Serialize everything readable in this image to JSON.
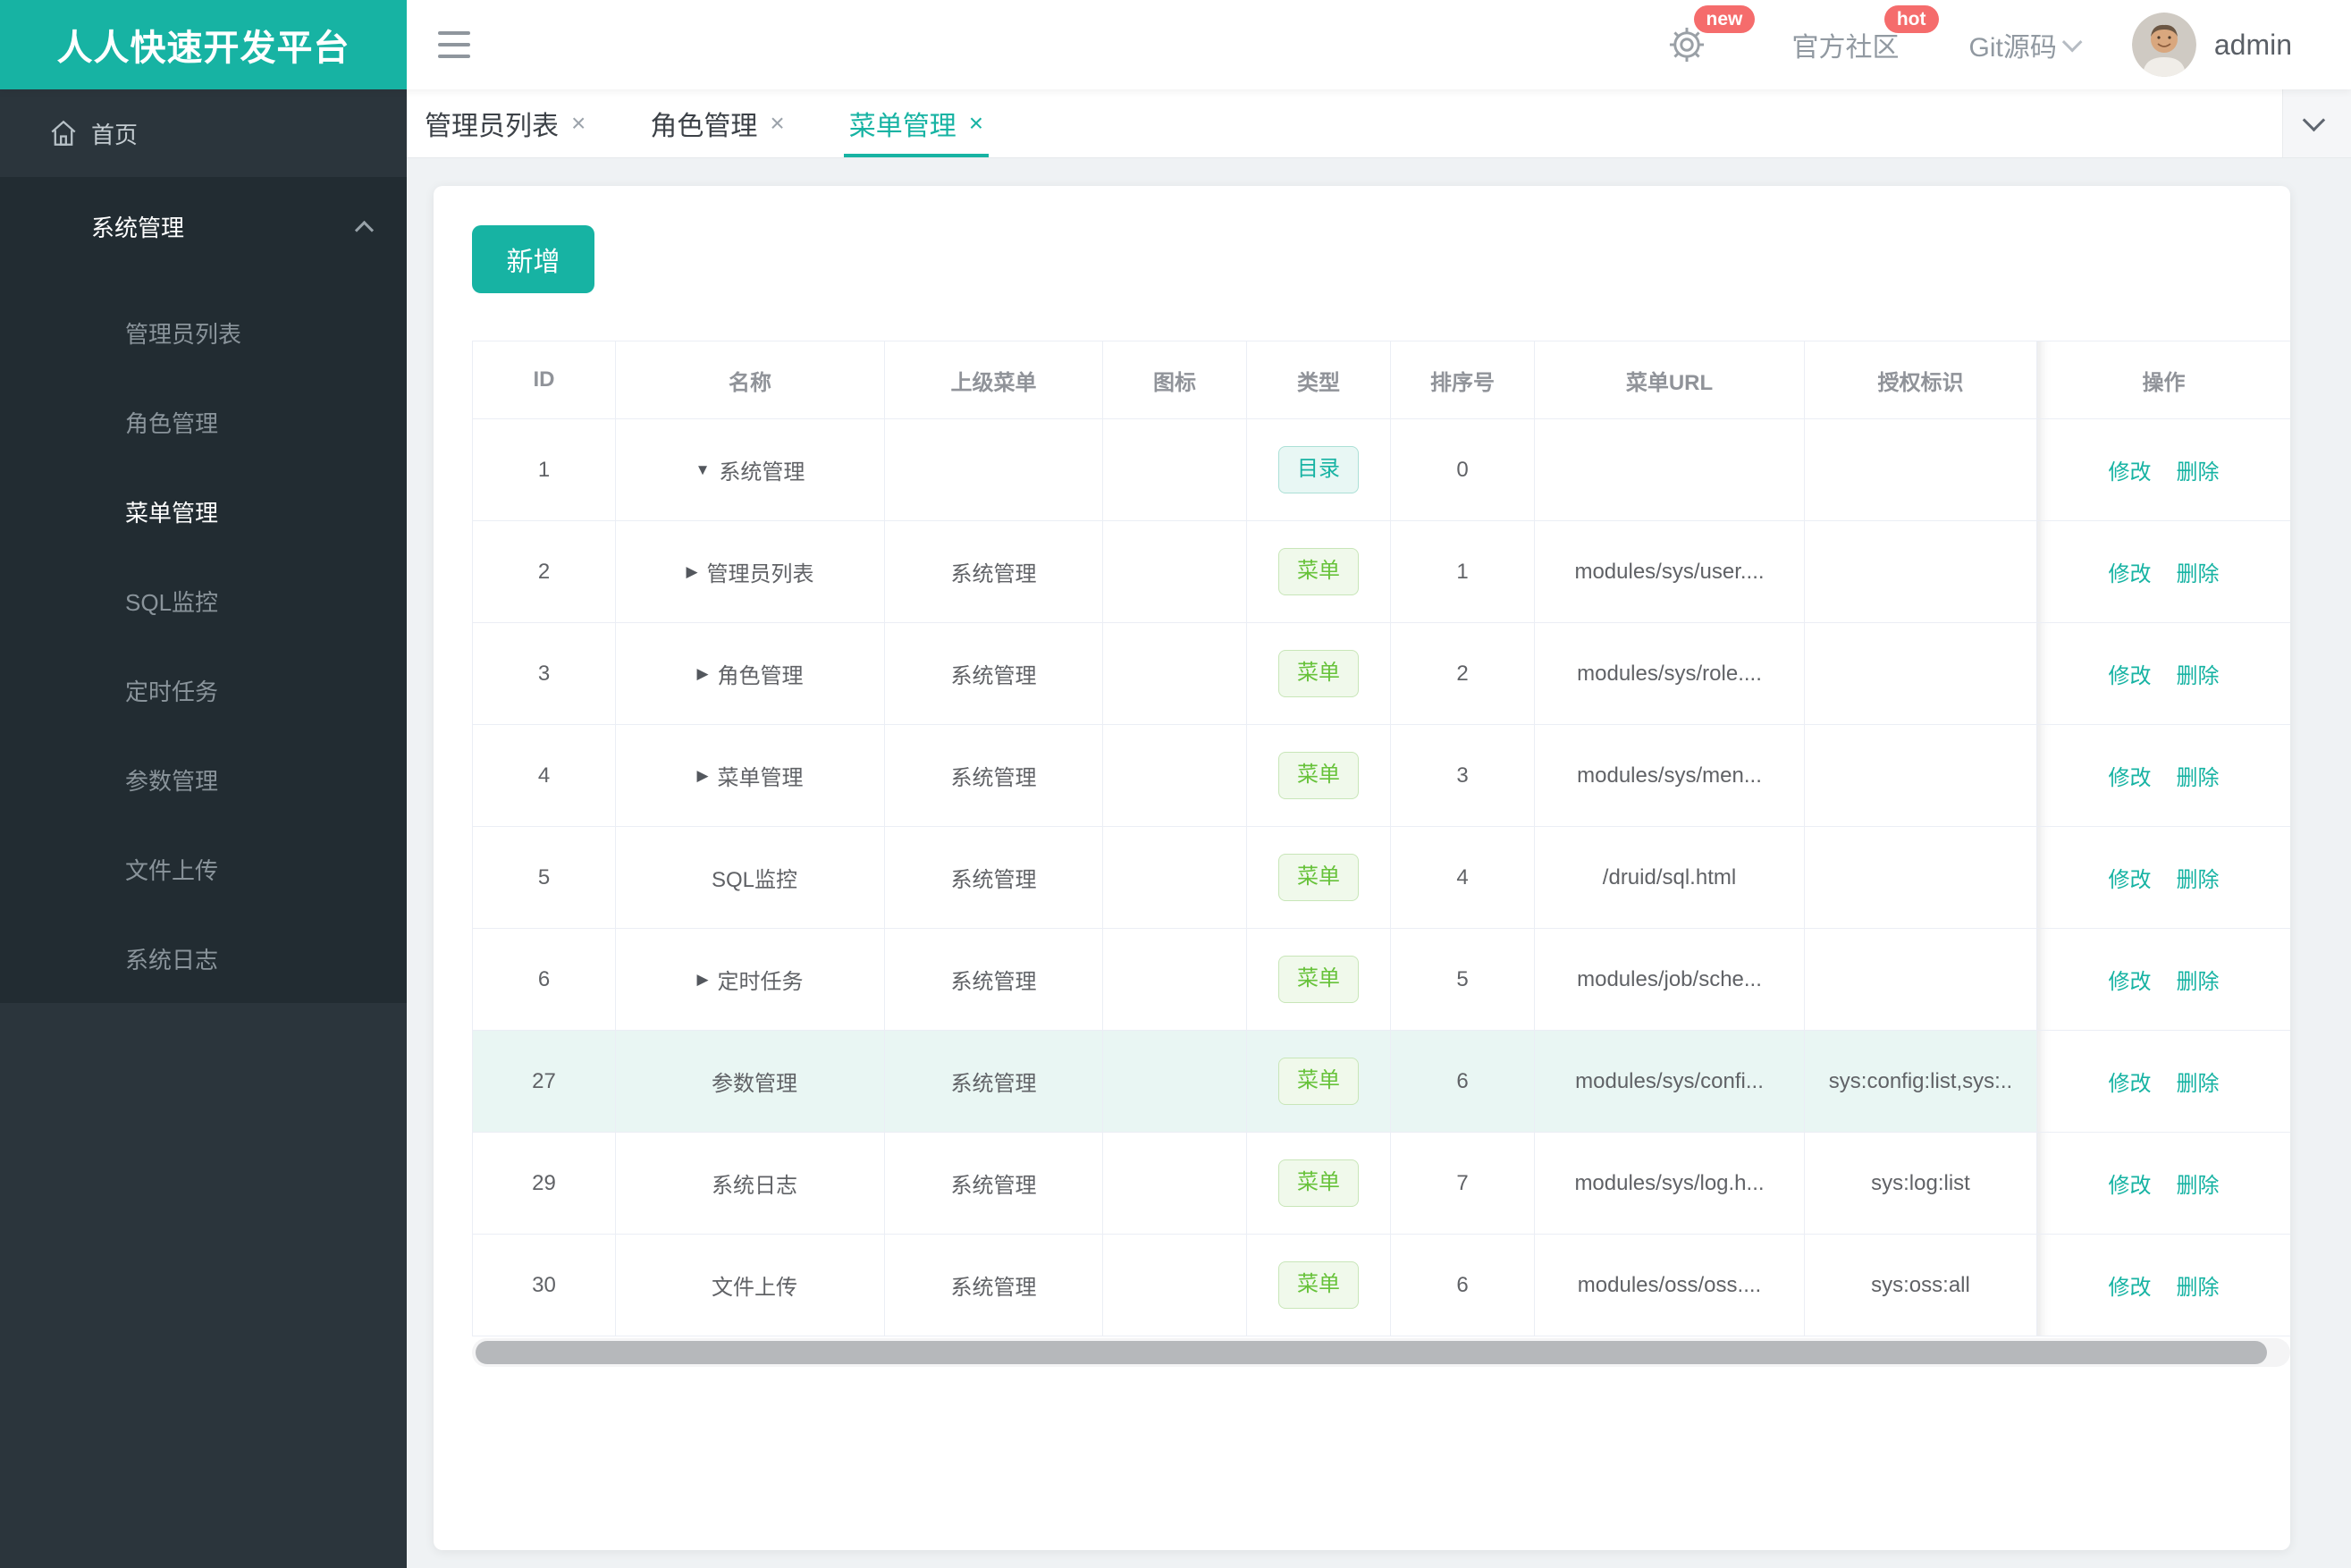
{
  "app": {
    "title": "人人快速开发平台"
  },
  "header": {
    "community_label": "官方社区",
    "git_label": "Git源码",
    "new_badge": "new",
    "hot_badge": "hot",
    "username": "admin"
  },
  "sidebar": {
    "home_label": "首页",
    "group_label": "系统管理",
    "items": [
      "管理员列表",
      "角色管理",
      "菜单管理",
      "SQL监控",
      "定时任务",
      "参数管理",
      "文件上传",
      "系统日志"
    ],
    "active_item": "菜单管理"
  },
  "tabs": [
    {
      "label": "管理员列表",
      "close": "×"
    },
    {
      "label": "角色管理",
      "close": "×"
    },
    {
      "label": "菜单管理",
      "close": "×",
      "active": true
    }
  ],
  "toolbar": {
    "add_label": "新增"
  },
  "table": {
    "columns": [
      "ID",
      "名称",
      "上级菜单",
      "图标",
      "类型",
      "排序号",
      "菜单URL",
      "授权标识",
      "操作"
    ],
    "action_edit": "修改",
    "action_delete": "删除",
    "rows": [
      {
        "id": "1",
        "arrow": "▼",
        "name": "系统管理",
        "parent": "",
        "type": "目录",
        "order": "0",
        "url": "",
        "perms": ""
      },
      {
        "id": "2",
        "arrow": "▶",
        "name": "管理员列表",
        "parent": "系统管理",
        "type": "菜单",
        "order": "1",
        "url": "modules/sys/user....",
        "perms": ""
      },
      {
        "id": "3",
        "arrow": "▶",
        "name": "角色管理",
        "parent": "系统管理",
        "type": "菜单",
        "order": "2",
        "url": "modules/sys/role....",
        "perms": ""
      },
      {
        "id": "4",
        "arrow": "▶",
        "name": "菜单管理",
        "parent": "系统管理",
        "type": "菜单",
        "order": "3",
        "url": "modules/sys/men...",
        "perms": ""
      },
      {
        "id": "5",
        "arrow": "",
        "name": "SQL监控",
        "parent": "系统管理",
        "type": "菜单",
        "order": "4",
        "url": "/druid/sql.html",
        "perms": ""
      },
      {
        "id": "6",
        "arrow": "▶",
        "name": "定时任务",
        "parent": "系统管理",
        "type": "菜单",
        "order": "5",
        "url": "modules/job/sche...",
        "perms": ""
      },
      {
        "id": "27",
        "arrow": "",
        "name": "参数管理",
        "parent": "系统管理",
        "type": "菜单",
        "order": "6",
        "url": "modules/sys/confi...",
        "perms": "sys:config:list,sys:.."
      },
      {
        "id": "29",
        "arrow": "",
        "name": "系统日志",
        "parent": "系统管理",
        "type": "菜单",
        "order": "7",
        "url": "modules/sys/log.h...",
        "perms": "sys:log:list"
      },
      {
        "id": "30",
        "arrow": "",
        "name": "文件上传",
        "parent": "系统管理",
        "type": "菜单",
        "order": "6",
        "url": "modules/oss/oss....",
        "perms": "sys:oss:all"
      }
    ]
  },
  "colors": {
    "accent": "#17B3A3",
    "sidebar_bg": "#2B353C",
    "sidebar_open_bg": "#222C32",
    "badge_red": "#F56C6C",
    "tag_menu_green": "#67C23A",
    "highlight_row": "#E9F6F3",
    "table_border": "#EBEEF5"
  }
}
